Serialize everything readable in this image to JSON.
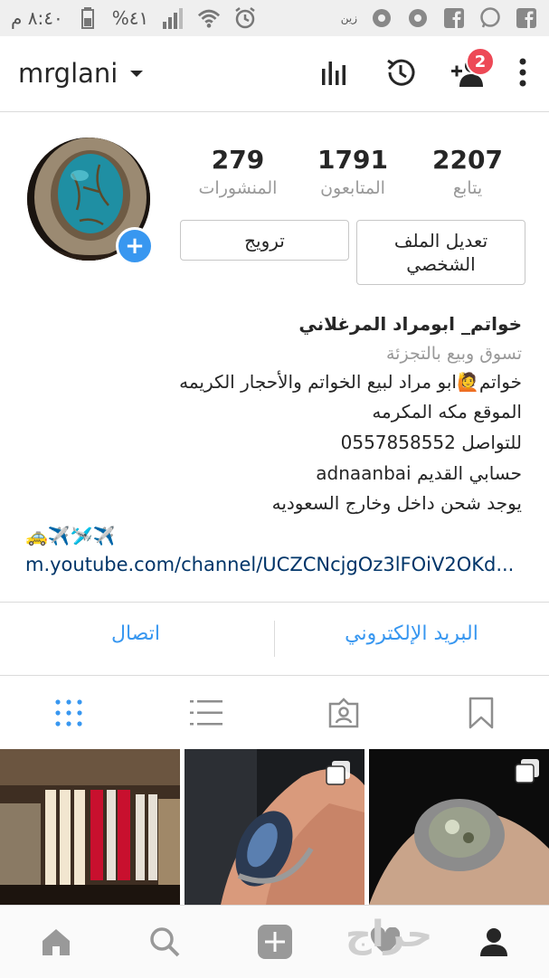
{
  "status_bar": {
    "time": "٨:٤٠ م",
    "battery": "%٤١",
    "carrier": "زين"
  },
  "header": {
    "username": "mrglani",
    "notification_count": "2"
  },
  "stats": [
    {
      "value": "279",
      "label": "المنشورات"
    },
    {
      "value": "1791",
      "label": "المتابعون"
    },
    {
      "value": "2207",
      "label": "يتابع"
    }
  ],
  "buttons": {
    "promote": "ترويج",
    "edit_profile_line1": "تعديل الملف",
    "edit_profile_line2": "الشخصي"
  },
  "bio": {
    "name": "خواتم_ ابومراد المرغلاني",
    "category": "تسوق وبيع بالتجزئة",
    "lines": [
      "خواتم🙋ابو مراد لبيع الخواتم والأحجار الكريمه",
      "الموقع مكه المكرمه",
      "للتواصل 0557858552",
      "حسابي القديم adnaanbai",
      "يوجد شحن داخل وخارج السعوديه"
    ],
    "emojis": "🚕✈️🛩️✈️",
    "link": "m.youtube.com/channel/UCZCNcjgOz3lFOiV2OKd..."
  },
  "contact": {
    "email": "البريد الإلكتروني",
    "call": "اتصال"
  },
  "watermark": "حراج",
  "colors": {
    "accent": "#3897f0",
    "badge": "#ed4956",
    "link": "#003569"
  },
  "icons": {
    "tabs": [
      "grid-icon",
      "list-icon",
      "tagged-icon",
      "saved-icon"
    ],
    "nav": [
      "home-icon",
      "search-icon",
      "add-icon",
      "heart-icon",
      "profile-icon"
    ]
  }
}
